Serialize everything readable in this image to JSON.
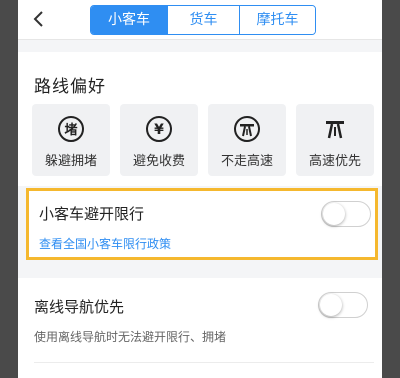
{
  "header": {
    "tabs": [
      {
        "label": "小客车",
        "active": true
      },
      {
        "label": "货车",
        "active": false
      },
      {
        "label": "摩托车",
        "active": false
      }
    ]
  },
  "route_pref": {
    "title": "路线偏好",
    "options": [
      {
        "label": "躲避拥堵",
        "icon": "congestion-icon"
      },
      {
        "label": "避免收费",
        "icon": "yen-toll-icon"
      },
      {
        "label": "不走高速",
        "icon": "no-highway-icon"
      },
      {
        "label": "高速优先",
        "icon": "highway-icon"
      }
    ]
  },
  "restriction": {
    "title": "小客车避开限行",
    "link": "查看全国小客车限行政策",
    "enabled": false
  },
  "offline": {
    "title": "离线导航优先",
    "subtitle": "使用离线导航时无法避开限行、拥堵",
    "enabled": false
  },
  "colors": {
    "accent": "#2f8ef2",
    "highlight_border": "#f5b82e"
  }
}
